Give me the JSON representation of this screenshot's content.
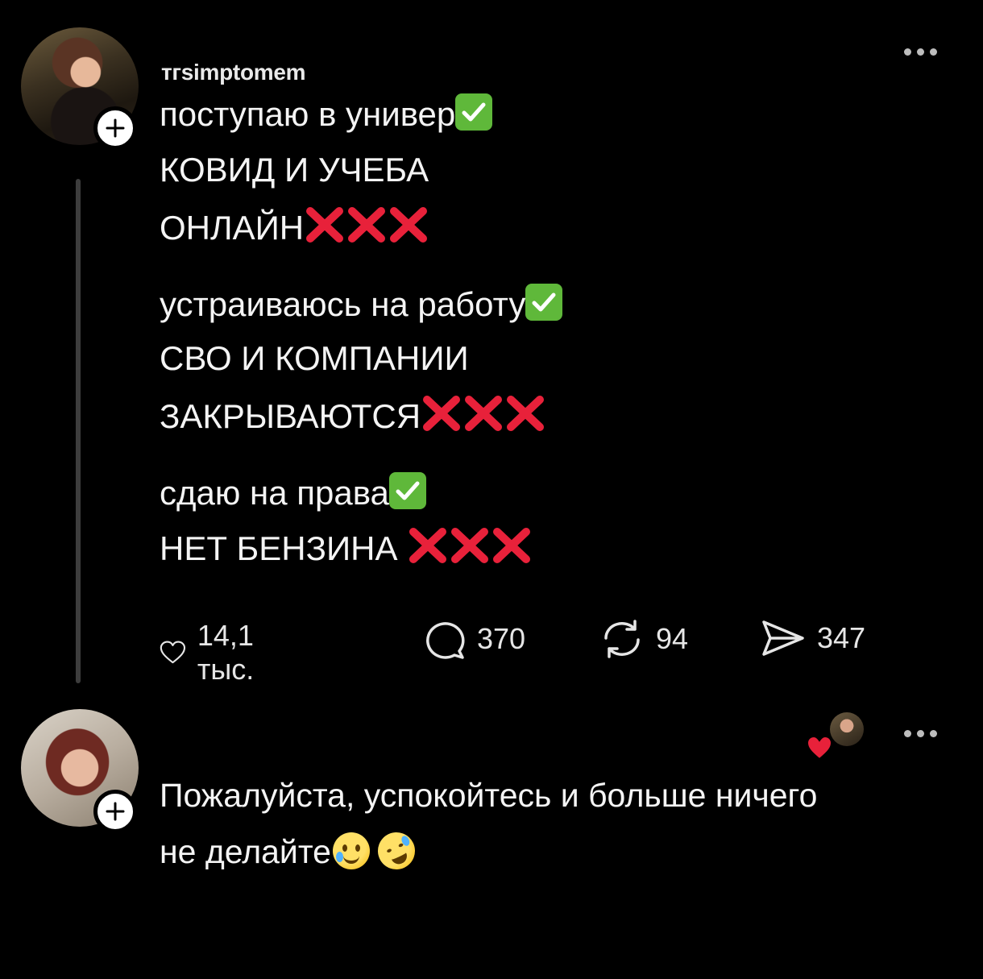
{
  "post": {
    "username": "тгsimptomem",
    "avatar_icon": "profile-photo",
    "lines": [
      {
        "text": "поступаю в универ",
        "marker": "check"
      },
      {
        "text": "КОВИД И УЧЕБА",
        "marker": ""
      },
      {
        "text": "ОНЛАЙН",
        "marker": "xxx"
      },
      {
        "text": "устраиваюсь на работу",
        "marker": "check"
      },
      {
        "text": "СВО И КОМПАНИИ",
        "marker": ""
      },
      {
        "text": "ЗАКРЫВАЮТСЯ",
        "marker": "xxx"
      },
      {
        "text": "сдаю на права",
        "marker": "check"
      },
      {
        "text": "НЕТ БЕНЗИНА ",
        "marker": "xxx"
      }
    ],
    "actions": {
      "likes": "14,1 тыс.",
      "comments": "370",
      "reposts": "94",
      "shares": "347"
    }
  },
  "reply": {
    "username": "",
    "line1": "Пожалуйста, успокойтесь и больше ничего",
    "line2": "не делайте"
  },
  "colors": {
    "background": "#000000",
    "check": "#5fb83a",
    "cross": "#e8213a",
    "heart": "#e8213a"
  }
}
